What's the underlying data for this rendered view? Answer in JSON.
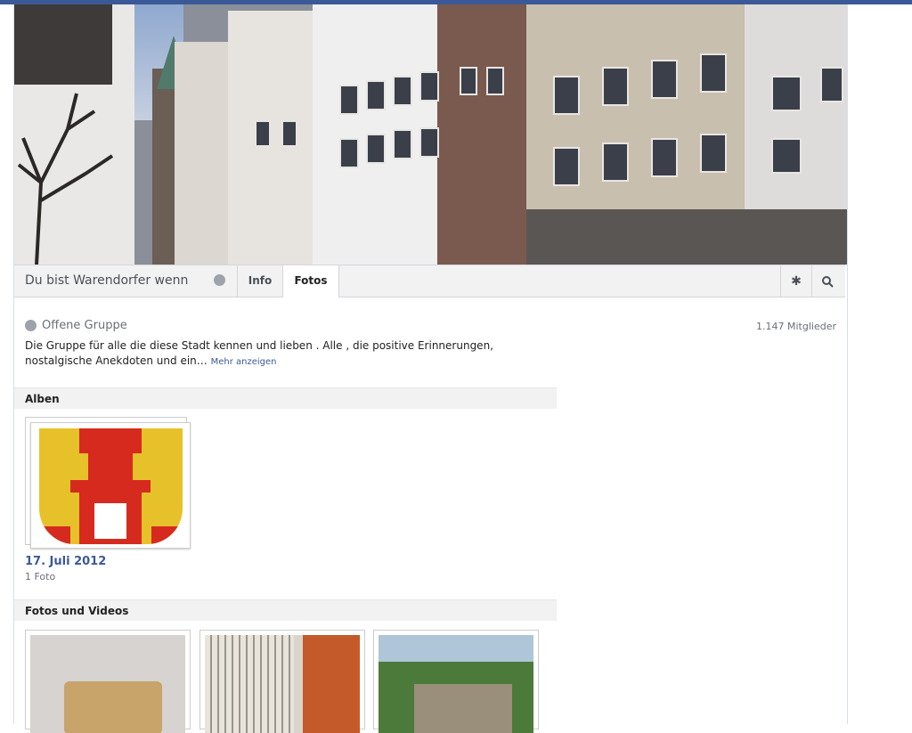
{
  "nav": {
    "group_name": "Du bist Warendorfer wenn",
    "tabs": [
      {
        "label": "Info"
      },
      {
        "label": "Fotos"
      }
    ],
    "gear_icon": "gear-icon",
    "search_icon": "search-icon"
  },
  "group": {
    "type_label": "Offene Gruppe",
    "members": "1.147 Mitglieder",
    "description": "Die Gruppe für alle die diese Stadt kennen und lieben . Alle , die positive Erinnerungen, nostalgische Anekdoten und ein…",
    "more_link": "Mehr anzeigen"
  },
  "albums": {
    "heading": "Alben",
    "items": [
      {
        "date": "17. Juli 2012",
        "count": "1 Foto"
      }
    ]
  },
  "photos": {
    "heading": "Fotos und Videos"
  },
  "colors": {
    "brand": "#3b5998",
    "crest_red": "#d62a1e",
    "crest_yellow": "#e7c12a"
  }
}
